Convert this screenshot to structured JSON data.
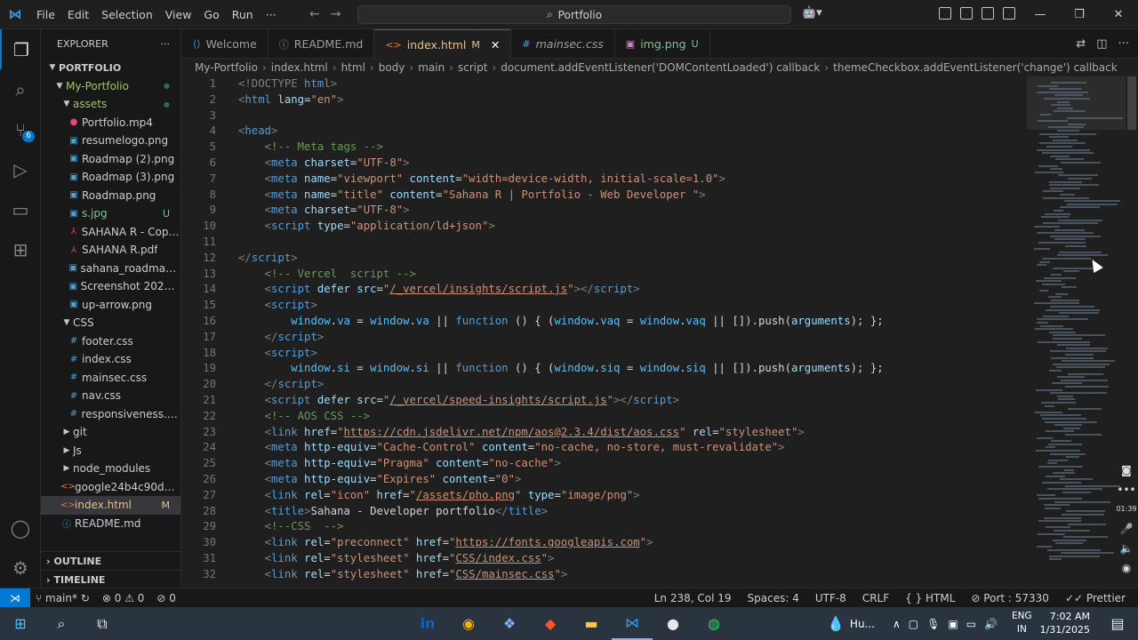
{
  "menu": [
    "File",
    "Edit",
    "Selection",
    "View",
    "Go",
    "Run",
    "···"
  ],
  "title_search": "Portfolio",
  "sidebar": {
    "title": "EXPLORER",
    "root": "PORTFOLIO",
    "items": [
      {
        "name": "My-Portfolio",
        "type": "folder",
        "depth": 1,
        "color": "#a0c46e",
        "status": "●"
      },
      {
        "name": "assets",
        "type": "folder",
        "depth": 2,
        "color": "#a0c46e",
        "status": "●"
      },
      {
        "name": "Portfolio.mp4",
        "type": "file",
        "depth": 3,
        "icon": "●",
        "iconColor": "#e8467c",
        "status": ""
      },
      {
        "name": "resumelogo.png",
        "type": "file",
        "depth": 3,
        "icon": "▣",
        "iconColor": "#4fa3d1",
        "status": ""
      },
      {
        "name": "Roadmap (2).png",
        "type": "file",
        "depth": 3,
        "icon": "▣",
        "iconColor": "#4fa3d1",
        "status": ""
      },
      {
        "name": "Roadmap (3).png",
        "type": "file",
        "depth": 3,
        "icon": "▣",
        "iconColor": "#4fa3d1",
        "status": ""
      },
      {
        "name": "Roadmap.png",
        "type": "file",
        "depth": 3,
        "icon": "▣",
        "iconColor": "#4fa3d1",
        "status": ""
      },
      {
        "name": "s.jpg",
        "type": "file",
        "depth": 3,
        "icon": "▣",
        "iconColor": "#4fa3d1",
        "status": "U",
        "color": "#73c991"
      },
      {
        "name": "SAHANA R - Copy...",
        "type": "file",
        "depth": 3,
        "icon": "⅄",
        "iconColor": "#e5484d",
        "status": ""
      },
      {
        "name": "SAHANA R.pdf",
        "type": "file",
        "depth": 3,
        "icon": "⅄",
        "iconColor": "#e5484d",
        "status": ""
      },
      {
        "name": "sahana_roadmap.p...",
        "type": "file",
        "depth": 3,
        "icon": "▣",
        "iconColor": "#4fa3d1",
        "status": ""
      },
      {
        "name": "Screenshot 2024-1...",
        "type": "file",
        "depth": 3,
        "icon": "▣",
        "iconColor": "#4fa3d1",
        "status": ""
      },
      {
        "name": "up-arrow.png",
        "type": "file",
        "depth": 3,
        "icon": "▣",
        "iconColor": "#4fa3d1",
        "status": ""
      },
      {
        "name": "CSS",
        "type": "folder",
        "depth": 2,
        "status": ""
      },
      {
        "name": "footer.css",
        "type": "file",
        "depth": 3,
        "icon": "#",
        "iconColor": "#4fa3d1",
        "status": ""
      },
      {
        "name": "index.css",
        "type": "file",
        "depth": 3,
        "icon": "#",
        "iconColor": "#4fa3d1",
        "status": ""
      },
      {
        "name": "mainsec.css",
        "type": "file",
        "depth": 3,
        "icon": "#",
        "iconColor": "#4fa3d1",
        "status": ""
      },
      {
        "name": "nav.css",
        "type": "file",
        "depth": 3,
        "icon": "#",
        "iconColor": "#4fa3d1",
        "status": ""
      },
      {
        "name": "responsiveness.css",
        "type": "file",
        "depth": 3,
        "icon": "#",
        "iconColor": "#4fa3d1",
        "status": ""
      },
      {
        "name": "git",
        "type": "folder-closed",
        "depth": 2,
        "status": ""
      },
      {
        "name": "Js",
        "type": "folder-closed",
        "depth": 2,
        "status": ""
      },
      {
        "name": "node_modules",
        "type": "folder-closed",
        "depth": 2,
        "status": ""
      },
      {
        "name": "google24b4c90d82...",
        "type": "file",
        "depth": 2,
        "icon": "<>",
        "iconColor": "#e37933",
        "status": ""
      },
      {
        "name": "index.html",
        "type": "file",
        "depth": 2,
        "icon": "<>",
        "iconColor": "#e37933",
        "status": "M",
        "color": "#e2c08d",
        "selected": true
      },
      {
        "name": "README.md",
        "type": "file",
        "depth": 2,
        "icon": "ⓘ",
        "iconColor": "#4fa3d1",
        "status": ""
      }
    ],
    "outline": "OUTLINE",
    "timeline": "TIMELINE"
  },
  "tabs": [
    {
      "label": "Welcome",
      "icon": "⟨⟩",
      "iconColor": "#2f9be8",
      "mod": ""
    },
    {
      "label": "README.md",
      "icon": "ⓘ",
      "iconColor": "#4fa3d1",
      "mod": ""
    },
    {
      "label": "index.html",
      "icon": "<>",
      "iconColor": "#e37933",
      "mod": "M",
      "active": true
    },
    {
      "label": "mainsec.css",
      "icon": "#",
      "iconColor": "#4fa3d1",
      "mod": "",
      "italic": true
    },
    {
      "label": "img.png",
      "icon": "▣",
      "iconColor": "#c586c0",
      "mod": "U"
    }
  ],
  "breadcrumb": [
    "My-Portfolio",
    "index.html",
    "html",
    "body",
    "main",
    "script",
    "document.addEventListener('DOMContentLoaded') callback",
    "themeCheckbox.addEventListener('change') callback"
  ],
  "code_lines": [
    [
      [
        "tg",
        "<!DOCTYPE "
      ],
      [
        "tn",
        "html"
      ],
      [
        "tg",
        ">"
      ]
    ],
    [
      [
        "tg",
        "<"
      ],
      [
        "tn",
        "html"
      ],
      [
        "at",
        " lang"
      ],
      [
        "tx",
        "="
      ],
      [
        "sv",
        "\"en\""
      ],
      [
        "tg",
        ">"
      ]
    ],
    [],
    [
      [
        "tg",
        "<"
      ],
      [
        "tn",
        "head"
      ],
      [
        "tg",
        ">"
      ]
    ],
    [
      [
        "tx",
        "    "
      ],
      [
        "cm",
        "<!-- Meta tags -->"
      ]
    ],
    [
      [
        "tx",
        "    "
      ],
      [
        "tg",
        "<"
      ],
      [
        "tn",
        "meta"
      ],
      [
        "at",
        " charset"
      ],
      [
        "tx",
        "="
      ],
      [
        "sv",
        "\"UTF-8\""
      ],
      [
        "tg",
        ">"
      ]
    ],
    [
      [
        "tx",
        "    "
      ],
      [
        "tg",
        "<"
      ],
      [
        "tn",
        "meta"
      ],
      [
        "at",
        " name"
      ],
      [
        "tx",
        "="
      ],
      [
        "sv",
        "\"viewport\""
      ],
      [
        "at",
        " content"
      ],
      [
        "tx",
        "="
      ],
      [
        "sv",
        "\"width=device-width, initial-scale=1.0\""
      ],
      [
        "tg",
        ">"
      ]
    ],
    [
      [
        "tx",
        "    "
      ],
      [
        "tg",
        "<"
      ],
      [
        "tn",
        "meta"
      ],
      [
        "at",
        " name"
      ],
      [
        "tx",
        "="
      ],
      [
        "sv",
        "\"title\""
      ],
      [
        "at",
        " content"
      ],
      [
        "tx",
        "="
      ],
      [
        "sv",
        "\"Sahana R | Portfolio - Web Developer \""
      ],
      [
        "tg",
        ">"
      ]
    ],
    [
      [
        "tx",
        "    "
      ],
      [
        "tg",
        "<"
      ],
      [
        "tn",
        "meta"
      ],
      [
        "at",
        " charset"
      ],
      [
        "tx",
        "="
      ],
      [
        "sv",
        "\"UTF-8\""
      ],
      [
        "tg",
        ">"
      ]
    ],
    [
      [
        "tx",
        "    "
      ],
      [
        "tg",
        "<"
      ],
      [
        "tn",
        "script"
      ],
      [
        "at",
        " type"
      ],
      [
        "tx",
        "="
      ],
      [
        "sv",
        "\"application/ld+json\""
      ],
      [
        "tg",
        ">"
      ]
    ],
    [],
    [
      [
        "tg",
        "</"
      ],
      [
        "tn",
        "script"
      ],
      [
        "tg",
        ">"
      ]
    ],
    [
      [
        "tx",
        "    "
      ],
      [
        "cm",
        "<!-- Vercel  script -->"
      ]
    ],
    [
      [
        "tx",
        "    "
      ],
      [
        "tg",
        "<"
      ],
      [
        "tn",
        "script"
      ],
      [
        "at",
        " defer"
      ],
      [
        "at",
        " src"
      ],
      [
        "tx",
        "="
      ],
      [
        "sv",
        "\""
      ],
      [
        "svu",
        "/_vercel/insights/script.js"
      ],
      [
        "sv",
        "\""
      ],
      [
        "tg",
        "></"
      ],
      [
        "tn",
        "script"
      ],
      [
        "tg",
        ">"
      ]
    ],
    [
      [
        "tx",
        "    "
      ],
      [
        "tg",
        "<"
      ],
      [
        "tn",
        "script"
      ],
      [
        "tg",
        ">"
      ]
    ],
    [
      [
        "tx",
        "        "
      ],
      [
        "ar",
        "window"
      ],
      [
        "tx",
        "."
      ],
      [
        "ar",
        "va"
      ],
      [
        "tx",
        " = "
      ],
      [
        "ar",
        "window"
      ],
      [
        "tx",
        "."
      ],
      [
        "ar",
        "va"
      ],
      [
        "tx",
        " || "
      ],
      [
        "kw",
        "function"
      ],
      [
        "tx",
        " () { ("
      ],
      [
        "ar",
        "window"
      ],
      [
        "tx",
        "."
      ],
      [
        "ar",
        "vaq"
      ],
      [
        "tx",
        " = "
      ],
      [
        "ar",
        "window"
      ],
      [
        "tx",
        "."
      ],
      [
        "ar",
        "vaq"
      ],
      [
        "tx",
        " || []).push("
      ],
      [
        "at",
        "arguments"
      ],
      [
        "tx",
        "); };"
      ]
    ],
    [
      [
        "tx",
        "    "
      ],
      [
        "tg",
        "</"
      ],
      [
        "tn",
        "script"
      ],
      [
        "tg",
        ">"
      ]
    ],
    [
      [
        "tx",
        "    "
      ],
      [
        "tg",
        "<"
      ],
      [
        "tn",
        "script"
      ],
      [
        "tg",
        ">"
      ]
    ],
    [
      [
        "tx",
        "        "
      ],
      [
        "ar",
        "window"
      ],
      [
        "tx",
        "."
      ],
      [
        "ar",
        "si"
      ],
      [
        "tx",
        " = "
      ],
      [
        "ar",
        "window"
      ],
      [
        "tx",
        "."
      ],
      [
        "ar",
        "si"
      ],
      [
        "tx",
        " || "
      ],
      [
        "kw",
        "function"
      ],
      [
        "tx",
        " () { ("
      ],
      [
        "ar",
        "window"
      ],
      [
        "tx",
        "."
      ],
      [
        "ar",
        "siq"
      ],
      [
        "tx",
        " = "
      ],
      [
        "ar",
        "window"
      ],
      [
        "tx",
        "."
      ],
      [
        "ar",
        "siq"
      ],
      [
        "tx",
        " || []).push("
      ],
      [
        "at",
        "arguments"
      ],
      [
        "tx",
        "); };"
      ]
    ],
    [
      [
        "tx",
        "    "
      ],
      [
        "tg",
        "</"
      ],
      [
        "tn",
        "script"
      ],
      [
        "tg",
        ">"
      ]
    ],
    [
      [
        "tx",
        "    "
      ],
      [
        "tg",
        "<"
      ],
      [
        "tn",
        "script"
      ],
      [
        "at",
        " defer"
      ],
      [
        "at",
        " src"
      ],
      [
        "tx",
        "="
      ],
      [
        "sv",
        "\""
      ],
      [
        "svu",
        "/_vercel/speed-insights/script.js"
      ],
      [
        "sv",
        "\""
      ],
      [
        "tg",
        "></"
      ],
      [
        "tn",
        "script"
      ],
      [
        "tg",
        ">"
      ]
    ],
    [
      [
        "tx",
        "    "
      ],
      [
        "cm",
        "<!-- AOS CSS -->"
      ]
    ],
    [
      [
        "tx",
        "    "
      ],
      [
        "tg",
        "<"
      ],
      [
        "tn",
        "link"
      ],
      [
        "at",
        " href"
      ],
      [
        "tx",
        "="
      ],
      [
        "sv",
        "\""
      ],
      [
        "svu",
        "https://cdn.jsdelivr.net/npm/aos@2.3.4/dist/aos.css"
      ],
      [
        "sv",
        "\""
      ],
      [
        "at",
        " rel"
      ],
      [
        "tx",
        "="
      ],
      [
        "sv",
        "\"stylesheet\""
      ],
      [
        "tg",
        ">"
      ]
    ],
    [
      [
        "tx",
        "    "
      ],
      [
        "tg",
        "<"
      ],
      [
        "tn",
        "meta"
      ],
      [
        "at",
        " http-equiv"
      ],
      [
        "tx",
        "="
      ],
      [
        "sv",
        "\"Cache-Control\""
      ],
      [
        "at",
        " content"
      ],
      [
        "tx",
        "="
      ],
      [
        "sv",
        "\"no-cache, no-store, must-revalidate\""
      ],
      [
        "tg",
        ">"
      ]
    ],
    [
      [
        "tx",
        "    "
      ],
      [
        "tg",
        "<"
      ],
      [
        "tn",
        "meta"
      ],
      [
        "at",
        " http-equiv"
      ],
      [
        "tx",
        "="
      ],
      [
        "sv",
        "\"Pragma\""
      ],
      [
        "at",
        " content"
      ],
      [
        "tx",
        "="
      ],
      [
        "sv",
        "\"no-cache\""
      ],
      [
        "tg",
        ">"
      ]
    ],
    [
      [
        "tx",
        "    "
      ],
      [
        "tg",
        "<"
      ],
      [
        "tn",
        "meta"
      ],
      [
        "at",
        " http-equiv"
      ],
      [
        "tx",
        "="
      ],
      [
        "sv",
        "\"Expires\""
      ],
      [
        "at",
        " content"
      ],
      [
        "tx",
        "="
      ],
      [
        "sv",
        "\"0\""
      ],
      [
        "tg",
        ">"
      ]
    ],
    [
      [
        "tx",
        "    "
      ],
      [
        "tg",
        "<"
      ],
      [
        "tn",
        "link"
      ],
      [
        "at",
        " rel"
      ],
      [
        "tx",
        "="
      ],
      [
        "sv",
        "\"icon\""
      ],
      [
        "at",
        " href"
      ],
      [
        "tx",
        "="
      ],
      [
        "sv",
        "\""
      ],
      [
        "svu",
        "/assets/pho.png"
      ],
      [
        "sv",
        "\""
      ],
      [
        "at",
        " type"
      ],
      [
        "tx",
        "="
      ],
      [
        "sv",
        "\"image/png\""
      ],
      [
        "tg",
        ">"
      ]
    ],
    [
      [
        "tx",
        "    "
      ],
      [
        "tg",
        "<"
      ],
      [
        "tn",
        "title"
      ],
      [
        "tg",
        ">"
      ],
      [
        "tx",
        "Sahana - Developer portfolio"
      ],
      [
        "tg",
        "</"
      ],
      [
        "tn",
        "title"
      ],
      [
        "tg",
        ">"
      ]
    ],
    [
      [
        "tx",
        "    "
      ],
      [
        "cm",
        "<!--CSS  -->"
      ]
    ],
    [
      [
        "tx",
        "    "
      ],
      [
        "tg",
        "<"
      ],
      [
        "tn",
        "link"
      ],
      [
        "at",
        " rel"
      ],
      [
        "tx",
        "="
      ],
      [
        "sv",
        "\"preconnect\""
      ],
      [
        "at",
        " href"
      ],
      [
        "tx",
        "="
      ],
      [
        "sv",
        "\""
      ],
      [
        "svu",
        "https://fonts.googleapis.com"
      ],
      [
        "sv",
        "\""
      ],
      [
        "tg",
        ">"
      ]
    ],
    [
      [
        "tx",
        "    "
      ],
      [
        "tg",
        "<"
      ],
      [
        "tn",
        "link"
      ],
      [
        "at",
        " rel"
      ],
      [
        "tx",
        "="
      ],
      [
        "sv",
        "\"stylesheet\""
      ],
      [
        "at",
        " href"
      ],
      [
        "tx",
        "="
      ],
      [
        "sv",
        "\""
      ],
      [
        "svu",
        "CSS/index.css"
      ],
      [
        "sv",
        "\""
      ],
      [
        "tg",
        ">"
      ]
    ],
    [
      [
        "tx",
        "    "
      ],
      [
        "tg",
        "<"
      ],
      [
        "tn",
        "link"
      ],
      [
        "at",
        " rel"
      ],
      [
        "tx",
        "="
      ],
      [
        "sv",
        "\"stylesheet\""
      ],
      [
        "at",
        " href"
      ],
      [
        "tx",
        "="
      ],
      [
        "sv",
        "\""
      ],
      [
        "svu",
        "CSS/mainsec.css"
      ],
      [
        "sv",
        "\""
      ],
      [
        "tg",
        ">"
      ]
    ]
  ],
  "status": {
    "branch": "main*",
    "problems": "⊗ 0 ⚠ 0",
    "ports_icon": "⊘ 0",
    "cursor": "Ln 238, Col 19",
    "spaces": "Spaces: 4",
    "encoding": "UTF-8",
    "eol": "CRLF",
    "language": "{ } HTML",
    "port": "⊘ Port : 57330",
    "prettier": "✓✓ Prettier"
  },
  "taskbar": {
    "weather": "Hu...",
    "lang_top": "ENG",
    "lang_bottom": "IN",
    "time": "7:02 AM",
    "date": "1/31/2025"
  },
  "sidewidget": [
    "◙",
    "•••",
    "01:39",
    "🎤",
    "🔈",
    "◉"
  ]
}
